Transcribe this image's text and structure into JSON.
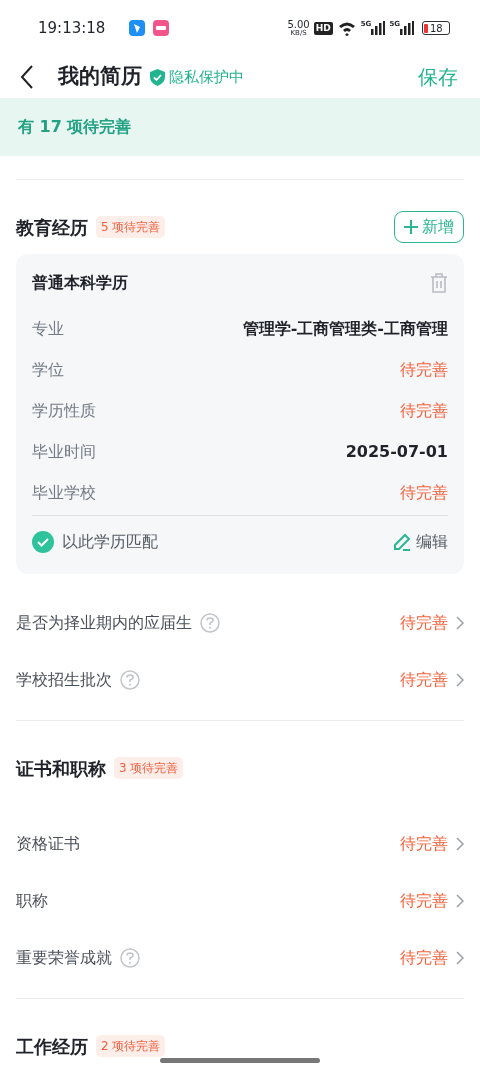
{
  "status_bar": {
    "time": "19:13:18",
    "speed": "5.00",
    "speed_unit": "KB/S",
    "hd": "HD",
    "networks": [
      "5G",
      "5G"
    ],
    "battery": "18"
  },
  "header": {
    "title": "我的简历",
    "privacy": "隐私保护中",
    "save": "保存"
  },
  "banner": "有 17 项待完善",
  "sections": [
    {
      "title": "教育经历",
      "badge": "5 项待完善",
      "add_button": "新增",
      "cards": [
        {
          "title": "普通本科学历",
          "fields": [
            {
              "label": "专业",
              "value": "管理学-工商管理类-工商管理",
              "kind": "filled"
            },
            {
              "label": "学位",
              "value": "待完善",
              "kind": "pending"
            },
            {
              "label": "学历性质",
              "value": "待完善",
              "kind": "pending"
            },
            {
              "label": "毕业时间",
              "value": "2025-07-01",
              "kind": "filled"
            },
            {
              "label": "毕业学校",
              "value": "待完善",
              "kind": "pending"
            }
          ],
          "match": {
            "label": "以此学历匹配",
            "checked": true
          },
          "edit": "编辑"
        }
      ],
      "rows": [
        {
          "label": "是否为择业期内的应届生",
          "help": true,
          "value": "待完善"
        },
        {
          "label": "学校招生批次",
          "help": true,
          "value": "待完善"
        }
      ]
    },
    {
      "title": "证书和职称",
      "badge": "3 项待完善",
      "rows": [
        {
          "label": "资格证书",
          "help": false,
          "value": "待完善"
        },
        {
          "label": "职称",
          "help": false,
          "value": "待完善"
        },
        {
          "label": "重要荣誉成就",
          "help": true,
          "value": "待完善"
        }
      ]
    },
    {
      "title": "工作经历",
      "badge": "2 项待完善"
    }
  ]
}
